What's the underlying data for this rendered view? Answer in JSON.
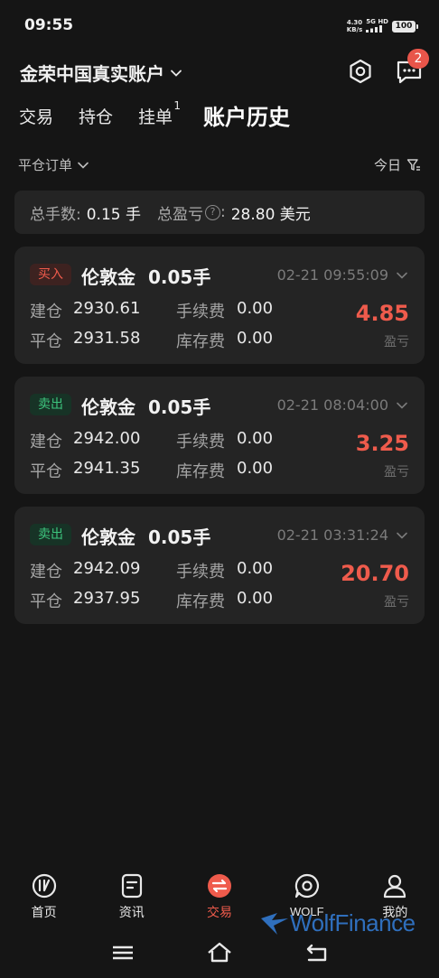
{
  "status_bar": {
    "time": "09:55",
    "net_speed_value": "4.30",
    "net_speed_unit": "KB/s",
    "network": "5G HD",
    "battery": "100"
  },
  "header": {
    "account_title": "金荣中国真实账户",
    "message_badge": "2"
  },
  "tabs": [
    {
      "label": "交易"
    },
    {
      "label": "持仓"
    },
    {
      "label": "挂单",
      "superscript": "1"
    },
    {
      "label": "账户历史"
    }
  ],
  "filter": {
    "left_label": "平仓订单",
    "right_label": "今日"
  },
  "summary": {
    "lots_label": "总手数:",
    "lots_value": "0.15 手",
    "pnl_label": "总盈亏",
    "pnl_suffix": ":",
    "pnl_value": "28.80 美元"
  },
  "orders": [
    {
      "side": "买入",
      "symbol": "伦敦金",
      "lots": "0.05手",
      "time": "02-21 09:55:09",
      "open_label": "建仓",
      "open_price": "2930.61",
      "close_label": "平仓",
      "close_price": "2931.58",
      "fee_label": "手续费",
      "fee": "0.00",
      "swap_label": "库存费",
      "swap": "0.00",
      "pnl": "4.85",
      "pnl_label": "盈亏"
    },
    {
      "side": "卖出",
      "symbol": "伦敦金",
      "lots": "0.05手",
      "time": "02-21 08:04:00",
      "open_label": "建仓",
      "open_price": "2942.00",
      "close_label": "平仓",
      "close_price": "2941.35",
      "fee_label": "手续费",
      "fee": "0.00",
      "swap_label": "库存费",
      "swap": "0.00",
      "pnl": "3.25",
      "pnl_label": "盈亏"
    },
    {
      "side": "卖出",
      "symbol": "伦敦金",
      "lots": "0.05手",
      "time": "02-21 03:31:24",
      "open_label": "建仓",
      "open_price": "2942.09",
      "close_label": "平仓",
      "close_price": "2937.95",
      "fee_label": "手续费",
      "fee": "0.00",
      "swap_label": "库存费",
      "swap": "0.00",
      "pnl": "20.70",
      "pnl_label": "盈亏"
    }
  ],
  "bottom_nav": [
    {
      "label": "首页",
      "icon": "home-icon"
    },
    {
      "label": "资讯",
      "icon": "news-icon"
    },
    {
      "label": "交易",
      "icon": "trade-icon"
    },
    {
      "label": "WOLF",
      "icon": "chat-icon"
    },
    {
      "label": "我的",
      "icon": "profile-icon"
    }
  ],
  "watermark": {
    "text": "WolfFinance"
  },
  "colors": {
    "background": "#151515",
    "card": "#242424",
    "profit_red": "#ef5b4c",
    "sell_green": "#3dc47d",
    "brand_blue": "#2f6fbd"
  }
}
